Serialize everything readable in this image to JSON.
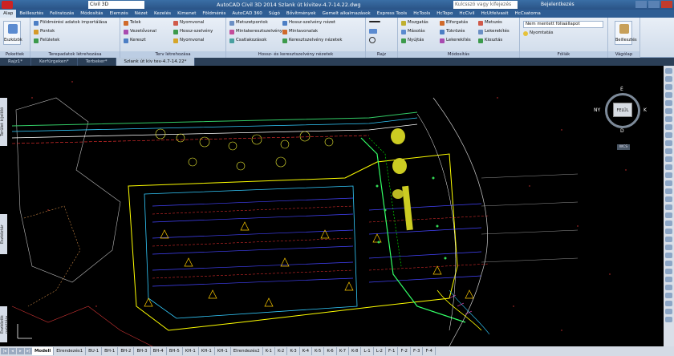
{
  "titlebar": {
    "workspace": "Civil 3D",
    "title": "AutoCAD Civil 3D 2014    Szlank út kivitev-4.7-14.22.dwg",
    "search_placeholder": "Kulcsszó vagy kifejezés",
    "user": "Bejelentkezés"
  },
  "ribbon_tabs": [
    "Alap",
    "Beillesztés",
    "Feliratozás",
    "Módosítás",
    "Elemzés",
    "Nézet",
    "Kezelés",
    "Kimenet",
    "Földmérés",
    "AutoCAD 360",
    "Súgó",
    "Bővítmények",
    "Gemelt alkalmazások",
    "Express Tools",
    "HcTools",
    "HcTopo",
    "HcCivil",
    "HcUtfelvasit",
    "HcCsatorna"
  ],
  "ribbon": {
    "p1_title": "Pokettek",
    "p1_btn": "Eszközök",
    "p2_items": [
      "Földmérési adatok importálása",
      "Pontok",
      "Felületek"
    ],
    "p2_title": "Terepadatok létrehozása",
    "p3_items": [
      "Telek",
      "Vezetővonal",
      "Kereszt",
      "Nyomvonal",
      "Hossz-szelvény",
      "Nyomvonal"
    ],
    "p3_title": "Terv létrehozása",
    "p4_items": [
      "Metszetpontok",
      "Mintakeresztszelvény",
      "Csatlakozások"
    ],
    "p5_items": [
      "Hossz-szelvény nézet",
      "Mintavonalak",
      "Keresztszelvény nézetek"
    ],
    "p45_title": "Hossz- és keresztszelvény nézetek",
    "p6_title": "Rajz",
    "p7_items": [
      "Mozgatás",
      "Másolás",
      "Nyújtás",
      "Elforgatás",
      "Tükrözés",
      "Lekerekítés",
      "Metszés",
      "Lekerekítés",
      "Kiosztás"
    ],
    "p7_title": "Módosítás",
    "p8_layer": "Nem mentett fóliaállapot",
    "p8_sub": "Nyomtatás",
    "p8_title": "Fóliák",
    "p9_btn": "Beillesztés",
    "p9_title": "Vágólap"
  },
  "file_tabs": [
    "Rajz1*",
    "Kerfürgeken*",
    "Terbeker*",
    "Szlank út kiv tev-4.7-14.22*"
  ],
  "left_labels": [
    "Terület kijelölő",
    "Eszköztár",
    "Eszközök palettája"
  ],
  "viewcube": {
    "face": "FELÜL",
    "n": "É",
    "s": "D",
    "e": "K",
    "w": "NY",
    "wcs": "WCS"
  },
  "layout_tabs": [
    "Modell",
    "Elrendezés1",
    "BU-1",
    "BH-1",
    "BH-2",
    "BH-3",
    "BH-4",
    "BH-5",
    "KH-1",
    "KH-1",
    "KH-1",
    "Elrendezés2",
    "K-1",
    "K-2",
    "K-3",
    "K-4",
    "K-5",
    "K-6",
    "K-7",
    "K-8",
    "L-1",
    "L-2",
    "F-1",
    "F-2",
    "F-3",
    "F-4"
  ],
  "colors": {
    "ribbon_bg": "#dbe6f3",
    "canvas_bg": "#000000",
    "accent": "#2f5e94"
  }
}
